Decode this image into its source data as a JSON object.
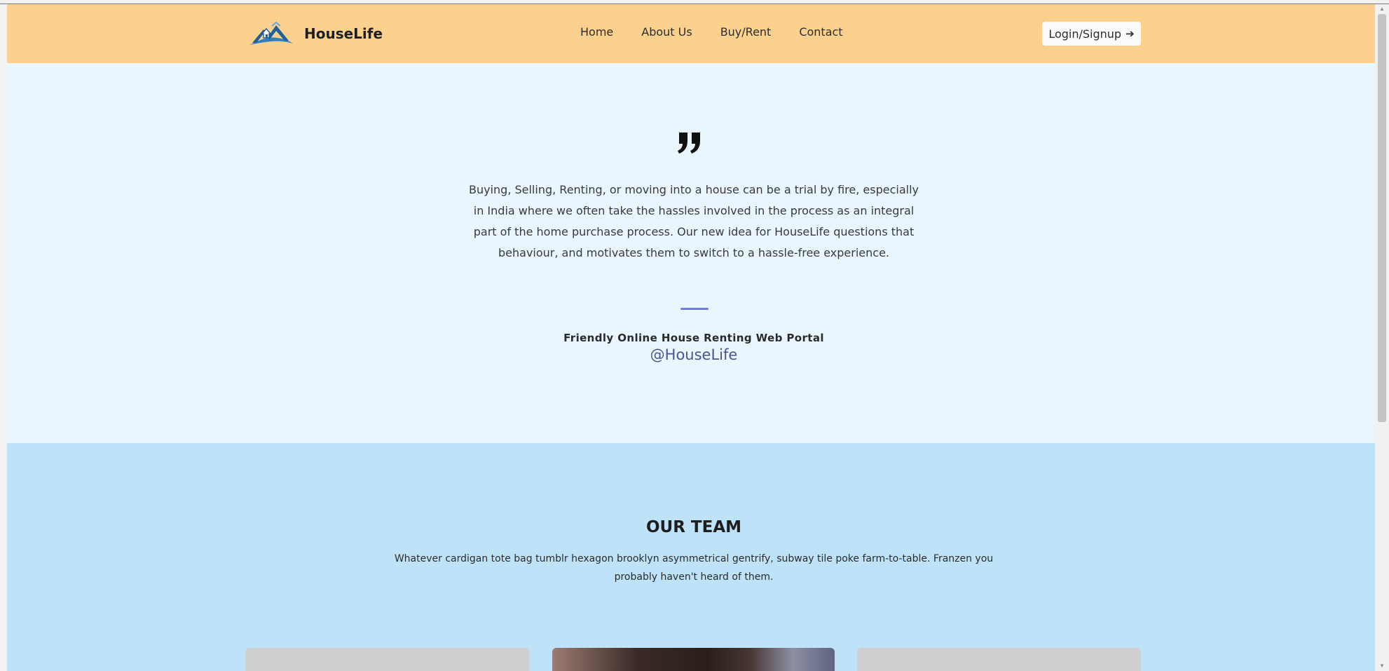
{
  "header": {
    "brand": "HouseLife",
    "logo_icon": "house-mountain-logo",
    "nav": [
      "Home",
      "About Us",
      "Buy/Rent",
      "Contact"
    ],
    "login_label": "Login/Signup",
    "login_icon": "arrow-right-icon"
  },
  "testimonial": {
    "quote_icon": "quote-icon",
    "text": "Buying, Selling, Renting, or moving into a house can be a trial by fire, especially in India where we often take the hassles involved in the process as an integral part of the home purchase process. Our new idea for HouseLife questions that behaviour, and motivates them to switch to a hassle-free experience.",
    "title": "Friendly Online House Renting Web Portal",
    "handle": "@HouseLife"
  },
  "team": {
    "title": "OUR TEAM",
    "description": "Whatever cardigan tote bag tumblr hexagon brooklyn asymmetrical gentrify, subway tile poke farm-to-table. Franzen you probably haven't heard of them."
  },
  "colors": {
    "header_bg": "#fcd18d",
    "testimonial_bg": "#e9f6fe",
    "team_bg": "#bee2f7",
    "accent": "#6f7fdd",
    "handle": "#4b548f"
  }
}
